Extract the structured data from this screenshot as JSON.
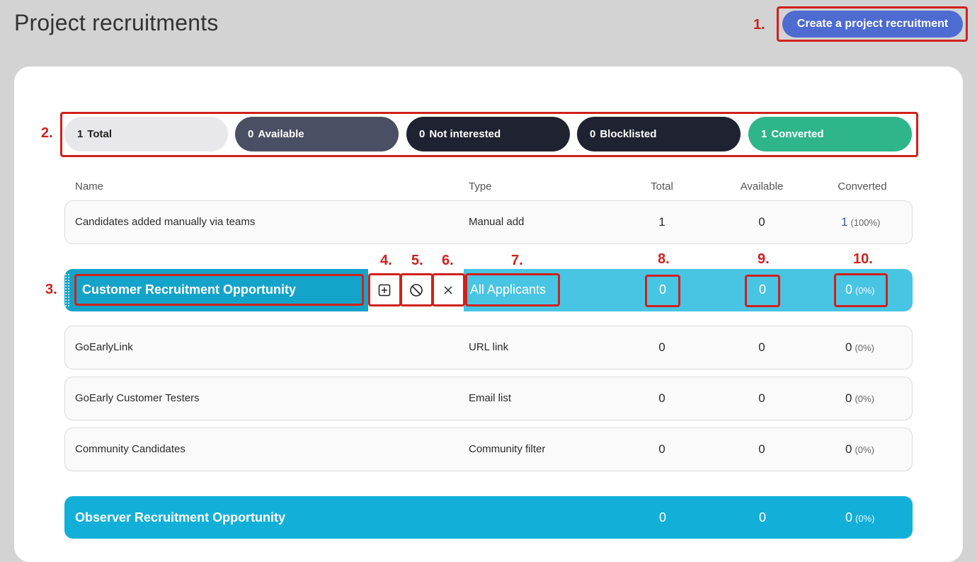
{
  "page": {
    "title": "Project recruitments"
  },
  "create_button": {
    "label": "Create a project recruitment"
  },
  "annotations": [
    "1.",
    "2.",
    "3.",
    "4.",
    "5.",
    "6.",
    "7.",
    "8.",
    "9.",
    "10."
  ],
  "summary": {
    "pills": [
      {
        "count": "1",
        "label": "Total",
        "color": "#e8e8ec",
        "text_color": "#222222"
      },
      {
        "count": "0",
        "label": "Available",
        "color": "#4a4f63",
        "text_color": "#ffffff"
      },
      {
        "count": "0",
        "label": "Not interested",
        "color": "#1f2230",
        "text_color": "#ffffff"
      },
      {
        "count": "0",
        "label": "Blocklisted",
        "color": "#1f2230",
        "text_color": "#ffffff"
      },
      {
        "count": "1",
        "label": "Converted",
        "color": "#2fb58a",
        "text_color": "#ffffff"
      }
    ]
  },
  "table": {
    "headers": {
      "name": "Name",
      "type": "Type",
      "total": "Total",
      "available": "Available",
      "converted": "Converted"
    },
    "rows": [
      {
        "name": "Candidates added manually via teams",
        "type": "Manual add",
        "total": "1",
        "available": "0",
        "converted": "1",
        "pct": "(100%)"
      },
      {
        "name": "GoEarlyLink",
        "type": "URL link",
        "total": "0",
        "available": "0",
        "converted": "0",
        "pct": "(0%)"
      },
      {
        "name": "GoEarly Customer Testers",
        "type": "Email list",
        "total": "0",
        "available": "0",
        "converted": "0",
        "pct": "(0%)"
      },
      {
        "name": "Community Candidates",
        "type": "Community filter",
        "total": "0",
        "available": "0",
        "converted": "0",
        "pct": "(0%)"
      }
    ],
    "highlighted": {
      "name": "Customer Recruitment Opportunity",
      "type": "All Applicants",
      "total": "0",
      "available": "0",
      "converted": "0",
      "pct": "(0%)",
      "actions": [
        {
          "icon": "add-box-icon"
        },
        {
          "icon": "block-icon"
        },
        {
          "icon": "close-icon"
        }
      ]
    },
    "observer": {
      "name": "Observer Recruitment Opportunity",
      "total": "0",
      "available": "0",
      "converted": "0",
      "pct": "(0%)"
    }
  },
  "colors": {
    "accent": "#4d6bd1",
    "annotation": "#d0211c",
    "highlight": "#48c5e3",
    "highlight_dark": "#14a3c9",
    "observer": "#12b0d8"
  }
}
